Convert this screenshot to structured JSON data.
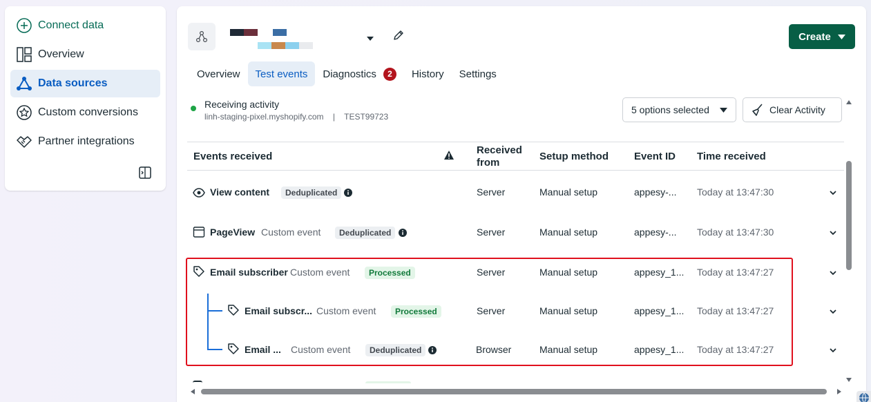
{
  "sidebar": {
    "items": [
      {
        "label": "Connect data",
        "icon": "plus-circle-icon"
      },
      {
        "label": "Overview",
        "icon": "dashboard-icon"
      },
      {
        "label": "Data sources",
        "icon": "nodes-icon"
      },
      {
        "label": "Custom conversions",
        "icon": "star-badge-icon"
      },
      {
        "label": "Partner integrations",
        "icon": "handshake-icon"
      }
    ],
    "active_index": 2
  },
  "header": {
    "create_label": "Create"
  },
  "tabs": [
    {
      "label": "Overview"
    },
    {
      "label": "Test events",
      "active": true
    },
    {
      "label": "Diagnostics",
      "badge": "2"
    },
    {
      "label": "History"
    },
    {
      "label": "Settings"
    }
  ],
  "status": {
    "title": "Receiving activity",
    "domain": "linh-staging-pixel.myshopify.com",
    "separator": "|",
    "code": "TEST99723"
  },
  "filters": {
    "options_label": "5 options selected",
    "clear_label": "Clear Activity"
  },
  "table": {
    "headers": {
      "events": "Events received",
      "received_from": "Received from",
      "setup": "Setup method",
      "event_id": "Event ID",
      "time": "Time received"
    },
    "rows": [
      {
        "name": "View content",
        "type": "",
        "status": "Deduplicated",
        "from": "Server",
        "setup": "Manual setup",
        "event_id": "appesy-...",
        "time": "Today at 13:47:30"
      },
      {
        "name": "PageView",
        "type": "Custom event",
        "status": "Deduplicated",
        "from": "Server",
        "setup": "Manual setup",
        "event_id": "appesy-...",
        "time": "Today at 13:47:30"
      },
      {
        "name": "Email subscriber",
        "type": "Custom event",
        "status": "Processed",
        "from": "Server",
        "setup": "Manual setup",
        "event_id": "appesy_1...",
        "time": "Today at 13:47:27"
      },
      {
        "name": "Email subscr...",
        "type": "Custom event",
        "status": "Processed",
        "from": "Server",
        "setup": "Manual setup",
        "event_id": "appesy_1...",
        "time": "Today at 13:47:27"
      },
      {
        "name": "Email ...",
        "type": "Custom event",
        "status": "Deduplicated",
        "from": "Browser",
        "setup": "Manual setup",
        "event_id": "appesy_1...",
        "time": "Today at 13:47:27"
      }
    ]
  },
  "colors": {
    "brand_green": "#075e45",
    "active_blue": "#0a5dc2",
    "badge_red": "#b3141d",
    "highlight_red": "#e0101d"
  }
}
